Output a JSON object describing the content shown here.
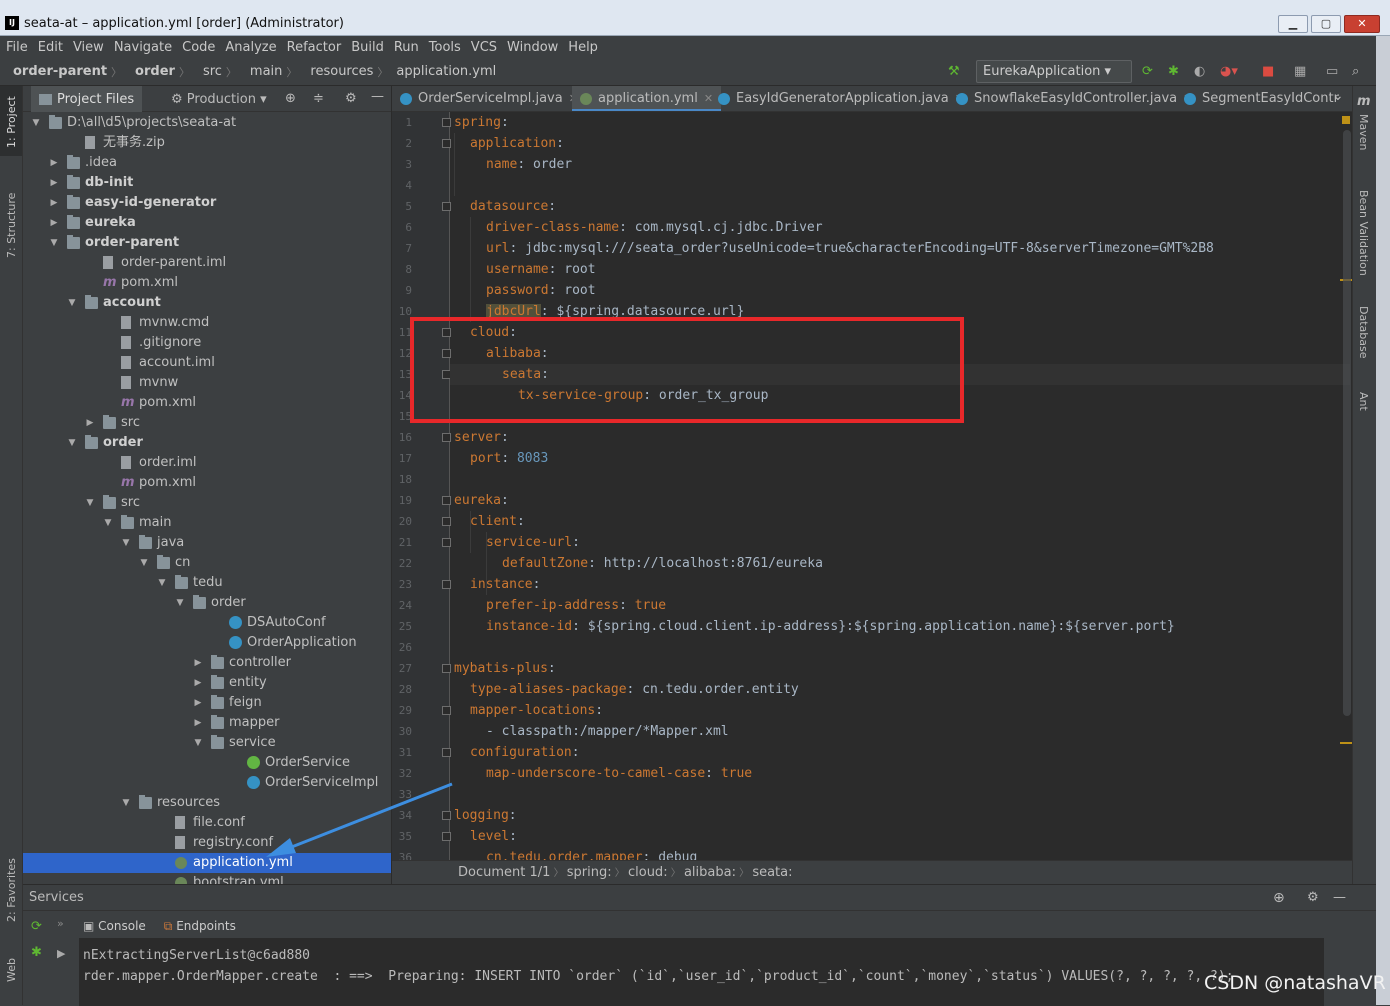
{
  "window": {
    "title": "seata-at – application.yml [order] (Administrator)",
    "icon": "IJ"
  },
  "menu": [
    "File",
    "Edit",
    "View",
    "Navigate",
    "Code",
    "Analyze",
    "Refactor",
    "Build",
    "Run",
    "Tools",
    "VCS",
    "Window",
    "Help"
  ],
  "breadcrumb": [
    "order-parent",
    "order",
    "src",
    "main",
    "resources",
    "application.yml"
  ],
  "toolbar": {
    "run_config": "EurekaApplication"
  },
  "left_stripe": {
    "project": "1: Project",
    "structure": "7: Structure",
    "favorites": "2: Favorites",
    "web": "Web"
  },
  "right_stripe": {
    "maven": "Maven",
    "bean": "Bean Validation",
    "database": "Database",
    "ant": "Ant"
  },
  "project_panel": {
    "tab": "Project Files",
    "scope": "Production",
    "tree": [
      {
        "label": "D:\\all\\d5\\projects\\seata-at",
        "depth": 0,
        "expanded": true,
        "kind": "folder"
      },
      {
        "label": "无事务.zip",
        "depth": 2,
        "kind": "file"
      },
      {
        "label": ".idea",
        "depth": 1,
        "expanded": false,
        "kind": "folder"
      },
      {
        "label": "db-init",
        "depth": 1,
        "expanded": false,
        "kind": "folder",
        "bold": true
      },
      {
        "label": "easy-id-generator",
        "depth": 1,
        "expanded": false,
        "kind": "folder",
        "bold": true
      },
      {
        "label": "eureka",
        "depth": 1,
        "expanded": false,
        "kind": "folder",
        "bold": true
      },
      {
        "label": "order-parent",
        "depth": 1,
        "expanded": true,
        "kind": "folder",
        "bold": true
      },
      {
        "label": "order-parent.iml",
        "depth": 3,
        "kind": "file"
      },
      {
        "label": "pom.xml",
        "depth": 3,
        "kind": "maven"
      },
      {
        "label": "account",
        "depth": 2,
        "expanded": true,
        "kind": "folder",
        "bold": true
      },
      {
        "label": "mvnw.cmd",
        "depth": 4,
        "kind": "file"
      },
      {
        "label": ".gitignore",
        "depth": 4,
        "kind": "file"
      },
      {
        "label": "account.iml",
        "depth": 4,
        "kind": "file"
      },
      {
        "label": "mvnw",
        "depth": 4,
        "kind": "file"
      },
      {
        "label": "pom.xml",
        "depth": 4,
        "kind": "maven"
      },
      {
        "label": "src",
        "depth": 3,
        "expanded": false,
        "kind": "folder"
      },
      {
        "label": "order",
        "depth": 2,
        "expanded": true,
        "kind": "folder",
        "bold": true
      },
      {
        "label": "order.iml",
        "depth": 4,
        "kind": "file"
      },
      {
        "label": "pom.xml",
        "depth": 4,
        "kind": "maven"
      },
      {
        "label": "src",
        "depth": 3,
        "expanded": true,
        "kind": "folder"
      },
      {
        "label": "main",
        "depth": 4,
        "expanded": true,
        "kind": "folder"
      },
      {
        "label": "java",
        "depth": 5,
        "expanded": true,
        "kind": "folder"
      },
      {
        "label": "cn",
        "depth": 6,
        "expanded": true,
        "kind": "folder"
      },
      {
        "label": "tedu",
        "depth": 7,
        "expanded": true,
        "kind": "folder"
      },
      {
        "label": "order",
        "depth": 8,
        "expanded": true,
        "kind": "folder"
      },
      {
        "label": "DSAutoConf",
        "depth": 10,
        "kind": "class"
      },
      {
        "label": "OrderApplication",
        "depth": 10,
        "kind": "class"
      },
      {
        "label": "controller",
        "depth": 9,
        "expanded": false,
        "kind": "folder"
      },
      {
        "label": "entity",
        "depth": 9,
        "expanded": false,
        "kind": "folder"
      },
      {
        "label": "feign",
        "depth": 9,
        "expanded": false,
        "kind": "folder"
      },
      {
        "label": "mapper",
        "depth": 9,
        "expanded": false,
        "kind": "folder"
      },
      {
        "label": "service",
        "depth": 9,
        "expanded": true,
        "kind": "folder"
      },
      {
        "label": "OrderService",
        "depth": 11,
        "kind": "interface"
      },
      {
        "label": "OrderServiceImpl",
        "depth": 11,
        "kind": "class"
      },
      {
        "label": "resources",
        "depth": 5,
        "expanded": true,
        "kind": "folder"
      },
      {
        "label": "file.conf",
        "depth": 7,
        "kind": "file"
      },
      {
        "label": "registry.conf",
        "depth": 7,
        "kind": "file"
      },
      {
        "label": "application.yml",
        "depth": 7,
        "kind": "yml",
        "selected": true
      },
      {
        "label": "bootstrap.yml",
        "depth": 7,
        "kind": "yml"
      }
    ]
  },
  "editor_tabs": [
    {
      "label": "OrderServiceImpl.java",
      "color": "#3592c4"
    },
    {
      "label": "application.yml",
      "color": "#6a8759",
      "active": true
    },
    {
      "label": "EasyIdGeneratorApplication.java",
      "color": "#3592c4"
    },
    {
      "label": "SnowflakeEasyIdController.java",
      "color": "#3592c4"
    },
    {
      "label": "SegmentEasyIdContr",
      "color": "#3592c4"
    }
  ],
  "code_lines": [
    {
      "n": "1",
      "i": 0,
      "k": "spring",
      "v": ""
    },
    {
      "n": "2",
      "i": 1,
      "k": "application",
      "v": ""
    },
    {
      "n": "3",
      "i": 2,
      "k": "name",
      "v": "order"
    },
    {
      "n": "4",
      "i": 0,
      "k": "",
      "v": ""
    },
    {
      "n": "5",
      "i": 1,
      "k": "datasource",
      "v": ""
    },
    {
      "n": "6",
      "i": 2,
      "k": "driver-class-name",
      "v": "com.mysql.cj.jdbc.Driver"
    },
    {
      "n": "7",
      "i": 2,
      "k": "url",
      "v": "jdbc:mysql:///seata_order?useUnicode=true&characterEncoding=UTF-8&serverTimezone=GMT%2B8"
    },
    {
      "n": "8",
      "i": 2,
      "k": "username",
      "v": "root"
    },
    {
      "n": "9",
      "i": 2,
      "k": "password",
      "v": "root"
    },
    {
      "n": "10",
      "i": 2,
      "k": "jdbcUrl",
      "v": "${spring.datasource.url}"
    },
    {
      "n": "11",
      "i": 1,
      "k": "cloud",
      "v": ""
    },
    {
      "n": "12",
      "i": 2,
      "k": "alibaba",
      "v": ""
    },
    {
      "n": "13",
      "i": 3,
      "k": "seata",
      "v": ""
    },
    {
      "n": "14",
      "i": 4,
      "k": "tx-service-group",
      "v": "order_tx_group"
    },
    {
      "n": "15",
      "i": 0,
      "k": "",
      "v": ""
    },
    {
      "n": "16",
      "i": 0,
      "k": "server",
      "v": ""
    },
    {
      "n": "17",
      "i": 1,
      "k": "port",
      "v": "8083",
      "num": true
    },
    {
      "n": "18",
      "i": 0,
      "k": "",
      "v": ""
    },
    {
      "n": "19",
      "i": 0,
      "k": "eureka",
      "v": ""
    },
    {
      "n": "20",
      "i": 1,
      "k": "client",
      "v": ""
    },
    {
      "n": "21",
      "i": 2,
      "k": "service-url",
      "v": ""
    },
    {
      "n": "22",
      "i": 3,
      "k": "defaultZone",
      "v": "http://localhost:8761/eureka"
    },
    {
      "n": "23",
      "i": 1,
      "k": "instance",
      "v": ""
    },
    {
      "n": "24",
      "i": 2,
      "k": "prefer-ip-address",
      "v": "true",
      "kw": true
    },
    {
      "n": "25",
      "i": 2,
      "k": "instance-id",
      "v": "${spring.cloud.client.ip-address}:${spring.application.name}:${server.port}"
    },
    {
      "n": "26",
      "i": 0,
      "k": "",
      "v": ""
    },
    {
      "n": "27",
      "i": 0,
      "k": "mybatis-plus",
      "v": ""
    },
    {
      "n": "28",
      "i": 1,
      "k": "type-aliases-package",
      "v": "cn.tedu.order.entity"
    },
    {
      "n": "29",
      "i": 1,
      "k": "mapper-locations",
      "v": ""
    },
    {
      "n": "30",
      "i": 2,
      "k": "",
      "v": "- classpath:/mapper/*Mapper.xml"
    },
    {
      "n": "31",
      "i": 1,
      "k": "configuration",
      "v": ""
    },
    {
      "n": "32",
      "i": 2,
      "k": "map-underscore-to-camel-case",
      "v": "true",
      "kw": true
    },
    {
      "n": "33",
      "i": 0,
      "k": "",
      "v": ""
    },
    {
      "n": "34",
      "i": 0,
      "k": "logging",
      "v": ""
    },
    {
      "n": "35",
      "i": 1,
      "k": "level",
      "v": ""
    },
    {
      "n": "36",
      "i": 2,
      "k": "cn.tedu.order.mapper",
      "v": "debug"
    }
  ],
  "editor_breadcrumb": [
    "Document 1/1",
    "spring:",
    "cloud:",
    "alibaba:",
    "seata:"
  ],
  "services": {
    "title": "Services",
    "tabs": [
      "Console",
      "Endpoints"
    ],
    "console_lines": [
      "nExtractingServerList@c6ad880",
      "rder.mapper.OrderMapper.create  : ==>  Preparing: INSERT INTO `order` (`id`,`user_id`,`product_id`,`count`,`money`,`status`) VALUES(?, ?, ?, ?, ?);"
    ]
  },
  "watermark": "CSDN @natashaVR"
}
